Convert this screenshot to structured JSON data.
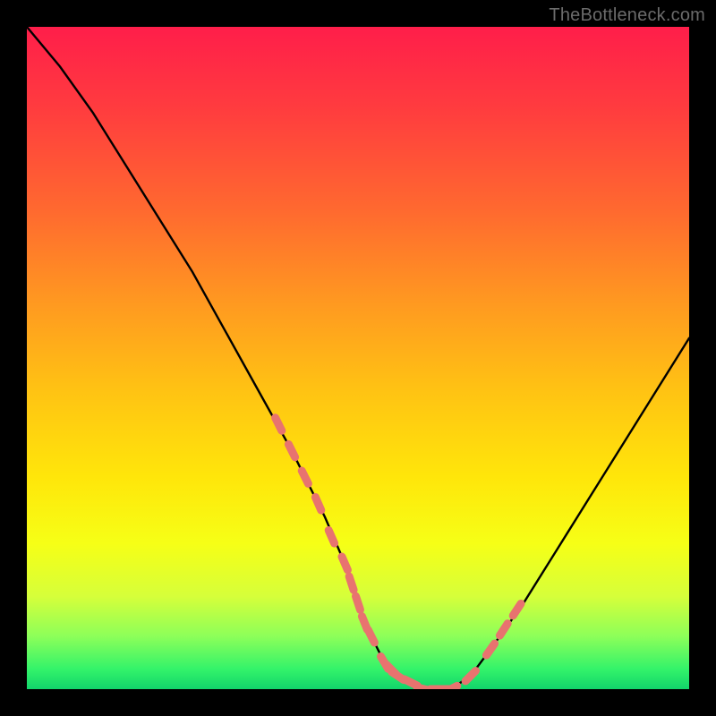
{
  "watermark": "TheBottleneck.com",
  "colors": {
    "background": "#000000",
    "gradient_top": "#ff1e4a",
    "gradient_bottom": "#12d46b",
    "curve": "#000000",
    "marker": "#e8736f"
  },
  "chart_data": {
    "type": "line",
    "title": "",
    "xlabel": "",
    "ylabel": "",
    "xlim": [
      0,
      100
    ],
    "ylim": [
      0,
      100
    ],
    "grid": false,
    "legend": false,
    "series": [
      {
        "name": "bottleneck-curve",
        "x": [
          0,
          5,
          10,
          15,
          20,
          25,
          30,
          35,
          40,
          45,
          48,
          50,
          52,
          54,
          56,
          58,
          60,
          62,
          64,
          67,
          70,
          75,
          80,
          85,
          90,
          95,
          100
        ],
        "values": [
          100,
          94,
          87,
          79,
          71,
          63,
          54,
          45,
          36,
          26,
          19,
          13,
          8,
          4,
          2,
          1,
          0,
          0,
          0,
          2,
          6,
          13,
          21,
          29,
          37,
          45,
          53
        ]
      }
    ],
    "markers": {
      "name": "highlight-dots",
      "x": [
        38,
        40,
        42,
        44,
        46,
        48,
        49,
        50,
        51,
        52,
        54,
        55,
        56,
        58,
        60,
        62,
        63,
        64,
        67,
        70,
        72,
        74
      ],
      "values": [
        40,
        36,
        32,
        28,
        23,
        19,
        16,
        13,
        10,
        8,
        4,
        3,
        2,
        1,
        0,
        0,
        0,
        0,
        2,
        6,
        9,
        12
      ]
    }
  }
}
